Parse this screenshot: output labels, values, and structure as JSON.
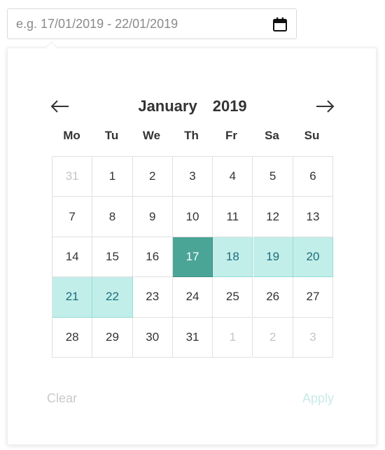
{
  "input": {
    "placeholder": "e.g. 17/01/2019 - 22/01/2019",
    "icon": "calendar-icon"
  },
  "calendar": {
    "month": "January",
    "year": "2019",
    "prev_icon": "arrow-left-icon",
    "next_icon": "arrow-right-icon",
    "weekdays": [
      "Mo",
      "Tu",
      "We",
      "Th",
      "Fr",
      "Sa",
      "Su"
    ],
    "selected_start": "17",
    "selected_range_end": "22",
    "weeks": [
      [
        "31",
        "1",
        "2",
        "3",
        "4",
        "5",
        "6"
      ],
      [
        "7",
        "8",
        "9",
        "10",
        "11",
        "12",
        "13"
      ],
      [
        "14",
        "15",
        "16",
        "17",
        "18",
        "19",
        "20"
      ],
      [
        "21",
        "22",
        "23",
        "24",
        "25",
        "26",
        "27"
      ],
      [
        "28",
        "29",
        "30",
        "31",
        "1",
        "2",
        "3"
      ]
    ],
    "cell_states": [
      [
        "other",
        "",
        "",
        "",
        "",
        "",
        ""
      ],
      [
        "",
        "",
        "",
        "",
        "",
        "",
        ""
      ],
      [
        "",
        "",
        "",
        "start",
        "range",
        "range",
        "range"
      ],
      [
        "range",
        "range",
        "",
        "",
        "",
        "",
        ""
      ],
      [
        "",
        "",
        "",
        "",
        "other",
        "other",
        "other"
      ]
    ]
  },
  "actions": {
    "clear_label": "Clear",
    "apply_label": "Apply"
  },
  "colors": {
    "selected_start": "#4aa596",
    "selected_range": "#c2eeea",
    "range_text": "#1e6c7a",
    "muted_text": "#c4c4c4"
  }
}
